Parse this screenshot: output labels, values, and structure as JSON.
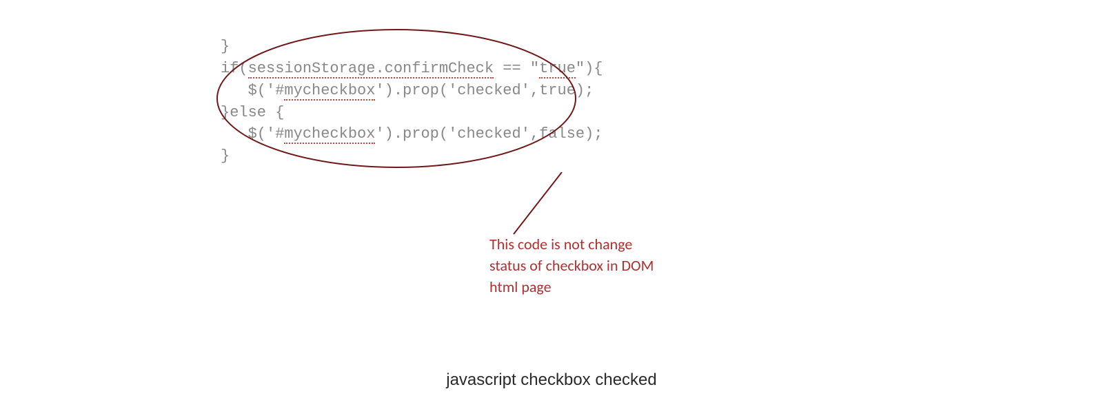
{
  "code": {
    "line1": "}",
    "line2_a": "if(",
    "line2_b": "sessionStorage.confirmCheck",
    "line2_c": " == \"",
    "line2_d": "true",
    "line2_e": "\"){",
    "line3_a": "   $('#",
    "line3_b": "mycheckbox",
    "line3_c": "').prop('checked',true);",
    "line4": "}else {",
    "line5_a": "   $('#",
    "line5_b": "mycheckbox",
    "line5_c": "').prop('checked',false);",
    "line6": "}"
  },
  "annotation": {
    "text": "This code is not change status of checkbox in DOM html page",
    "color": "#a82020"
  },
  "caption": "javascript checkbox checked"
}
